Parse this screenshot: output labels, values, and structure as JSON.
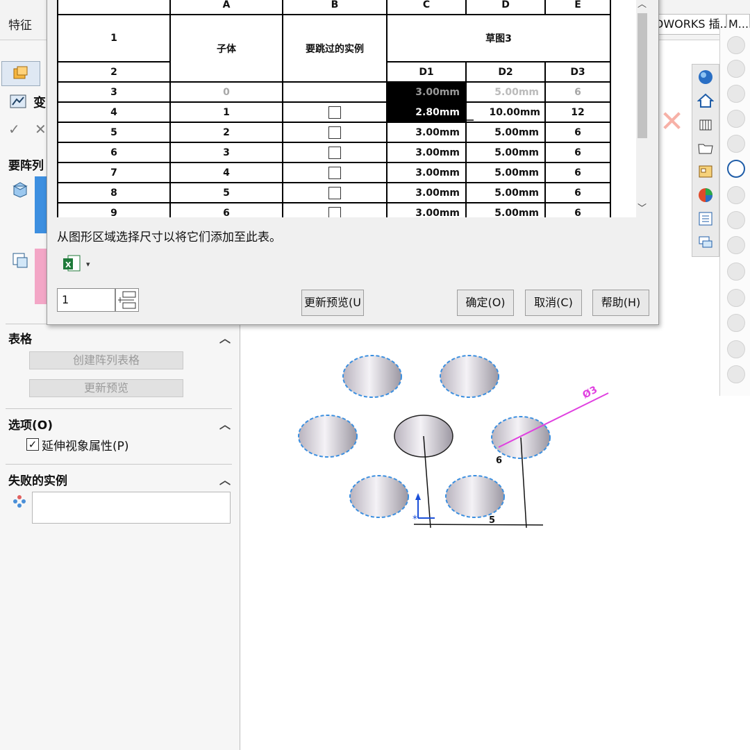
{
  "ribbon": {
    "feature_tab": "特征",
    "sw_tab": "DWORKS 插...",
    "m_tab": "M..."
  },
  "pm": {
    "title": "变",
    "section_array": "要阵列",
    "section_table": "表格",
    "create_table_btn": "创建阵列表格",
    "update_preview_btn": "更新预览",
    "section_options": "选项(O)",
    "extend_visual_label": "延伸视象属性(P)",
    "extend_visual_checked": true,
    "section_failed": "失败的实例"
  },
  "dialog": {
    "col_letters": [
      "A",
      "B",
      "C",
      "D",
      "E"
    ],
    "header_child": "子体",
    "header_skip": "要跳过的实例",
    "header_sketch": "草图3",
    "dim_cols": [
      "D1",
      "D2",
      "D3"
    ],
    "rows": [
      {
        "num": "3",
        "child": "0",
        "d1": "3.00mm",
        "d2": "5.00mm",
        "d3": "6"
      },
      {
        "num": "4",
        "child": "1",
        "d1": "2.80mm",
        "d2": "10.00mm",
        "d3": "12"
      },
      {
        "num": "5",
        "child": "2",
        "d1": "3.00mm",
        "d2": "5.00mm",
        "d3": "6"
      },
      {
        "num": "6",
        "child": "3",
        "d1": "3.00mm",
        "d2": "5.00mm",
        "d3": "6"
      },
      {
        "num": "7",
        "child": "4",
        "d1": "3.00mm",
        "d2": "5.00mm",
        "d3": "6"
      },
      {
        "num": "8",
        "child": "5",
        "d1": "3.00mm",
        "d2": "5.00mm",
        "d3": "6"
      },
      {
        "num": "9",
        "child": "6",
        "d1": "3.00mm",
        "d2": "5.00mm",
        "d3": "6"
      }
    ],
    "header_row_nums": [
      "1",
      "2"
    ],
    "hint": "从图形区域选择尺寸以将它们添加至此表。",
    "input_value": "1",
    "update_preview": "更新预览(U",
    "ok": "确定(O)",
    "cancel": "取消(C)",
    "help": "帮助(H)"
  },
  "graphics": {
    "dim_dia": "Ø3",
    "dim_six": "6",
    "dim_five": "5"
  },
  "colors": {
    "accent_blue": "#3d8fe0",
    "dim_magenta": "#e040e0",
    "sel_black": "#000000"
  }
}
